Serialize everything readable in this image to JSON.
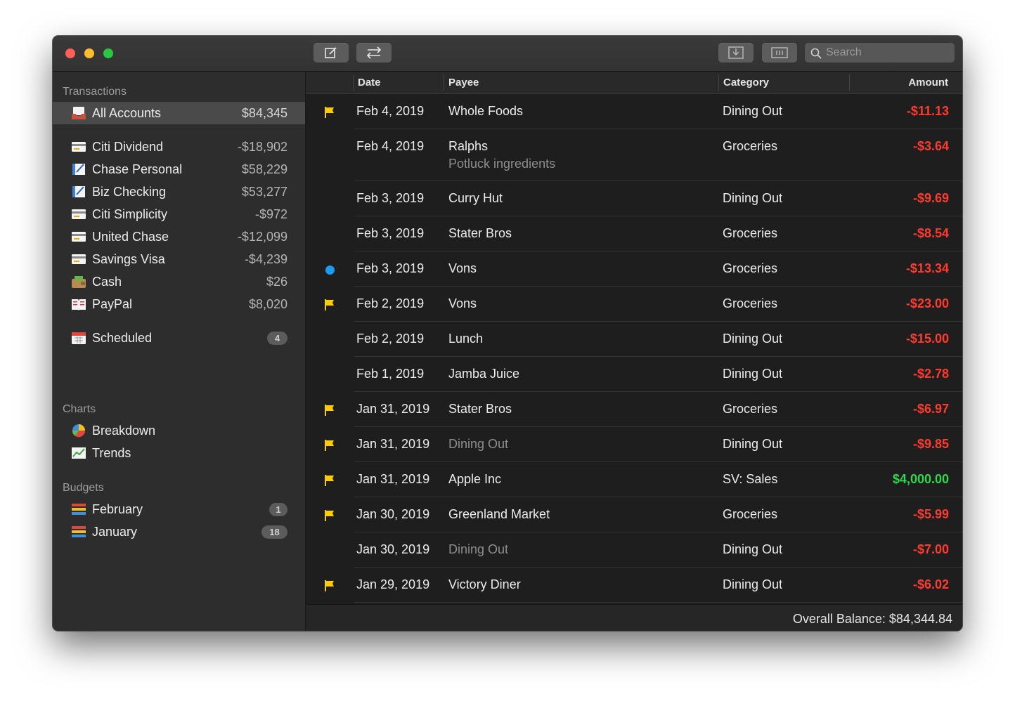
{
  "toolbar": {
    "search_placeholder": "Search"
  },
  "colors": {
    "negative": "#ff3b30",
    "positive": "#32d74b",
    "flag": "#ffcc00",
    "dot": "#1a9cf2"
  },
  "sidebar": {
    "transactions_title": "Transactions",
    "all_accounts": {
      "label": "All Accounts",
      "balance": "$84,345",
      "icon": "inbox-tray-icon"
    },
    "accounts": [
      {
        "label": "Citi Dividend",
        "balance": "-$18,902",
        "icon": "credit-card-icon"
      },
      {
        "label": "Chase Personal",
        "balance": "$58,229",
        "icon": "checkbook-icon"
      },
      {
        "label": "Biz Checking",
        "balance": "$53,277",
        "icon": "checkbook-icon"
      },
      {
        "label": "Citi Simplicity",
        "balance": "-$972",
        "icon": "credit-card-icon"
      },
      {
        "label": "United Chase",
        "balance": "-$12,099",
        "icon": "credit-card-icon"
      },
      {
        "label": "Savings Visa",
        "balance": "-$4,239",
        "icon": "credit-card-icon"
      },
      {
        "label": "Cash",
        "balance": "$26",
        "icon": "wallet-icon"
      },
      {
        "label": "PayPal",
        "balance": "$8,020",
        "icon": "book-icon"
      }
    ],
    "scheduled": {
      "label": "Scheduled",
      "badge": "4",
      "icon": "calendar-icon"
    },
    "charts_title": "Charts",
    "charts": [
      {
        "label": "Breakdown",
        "icon": "pie-chart-icon"
      },
      {
        "label": "Trends",
        "icon": "line-chart-icon"
      }
    ],
    "budgets_title": "Budgets",
    "budgets": [
      {
        "label": "February",
        "badge": "1",
        "icon": "budget-bars-icon"
      },
      {
        "label": "January",
        "badge": "18",
        "icon": "budget-bars-icon"
      }
    ],
    "add_label": "+"
  },
  "table": {
    "columns": {
      "date": "Date",
      "payee": "Payee",
      "category": "Category",
      "amount": "Amount"
    },
    "rows": [
      {
        "marker": "flag",
        "date": "Feb 4, 2019",
        "payee": "Whole Foods",
        "category": "Dining Out",
        "amount": "-$11.13",
        "sign": "neg"
      },
      {
        "marker": "",
        "date": "Feb 4, 2019",
        "payee": "Ralphs",
        "memo": "Potluck ingredients",
        "category": "Groceries",
        "amount": "-$3.64",
        "sign": "neg"
      },
      {
        "marker": "",
        "date": "Feb 3, 2019",
        "payee": "Curry Hut",
        "category": "Dining Out",
        "amount": "-$9.69",
        "sign": "neg"
      },
      {
        "marker": "",
        "date": "Feb 3, 2019",
        "payee": "Stater Bros",
        "category": "Groceries",
        "amount": "-$8.54",
        "sign": "neg"
      },
      {
        "marker": "dot",
        "date": "Feb 3, 2019",
        "payee": "Vons",
        "category": "Groceries",
        "amount": "-$13.34",
        "sign": "neg"
      },
      {
        "marker": "flag",
        "date": "Feb 2, 2019",
        "payee": "Vons",
        "category": "Groceries",
        "amount": "-$23.00",
        "sign": "neg"
      },
      {
        "marker": "",
        "date": "Feb 2, 2019",
        "payee": "Lunch",
        "category": "Dining Out",
        "amount": "-$15.00",
        "sign": "neg"
      },
      {
        "marker": "",
        "date": "Feb 1, 2019",
        "payee": "Jamba Juice",
        "category": "Dining Out",
        "amount": "-$2.78",
        "sign": "neg"
      },
      {
        "marker": "flag",
        "date": "Jan 31, 2019",
        "payee": "Stater Bros",
        "category": "Groceries",
        "amount": "-$6.97",
        "sign": "neg"
      },
      {
        "marker": "flag",
        "date": "Jan 31, 2019",
        "payee": "Dining Out",
        "payee_muted": true,
        "category": "Dining Out",
        "amount": "-$9.85",
        "sign": "neg"
      },
      {
        "marker": "flag",
        "date": "Jan 31, 2019",
        "payee": "Apple Inc",
        "category": "SV: Sales",
        "amount": "$4,000.00",
        "sign": "pos"
      },
      {
        "marker": "flag",
        "date": "Jan 30, 2019",
        "payee": "Greenland Market",
        "category": "Groceries",
        "amount": "-$5.99",
        "sign": "neg"
      },
      {
        "marker": "",
        "date": "Jan 30, 2019",
        "payee": "Dining Out",
        "payee_muted": true,
        "category": "Dining Out",
        "amount": "-$7.00",
        "sign": "neg"
      },
      {
        "marker": "flag",
        "date": "Jan 29, 2019",
        "payee": "Victory Diner",
        "category": "Dining Out",
        "amount": "-$6.02",
        "sign": "neg"
      }
    ]
  },
  "status": {
    "overall_balance": "Overall Balance: $84,344.84"
  }
}
